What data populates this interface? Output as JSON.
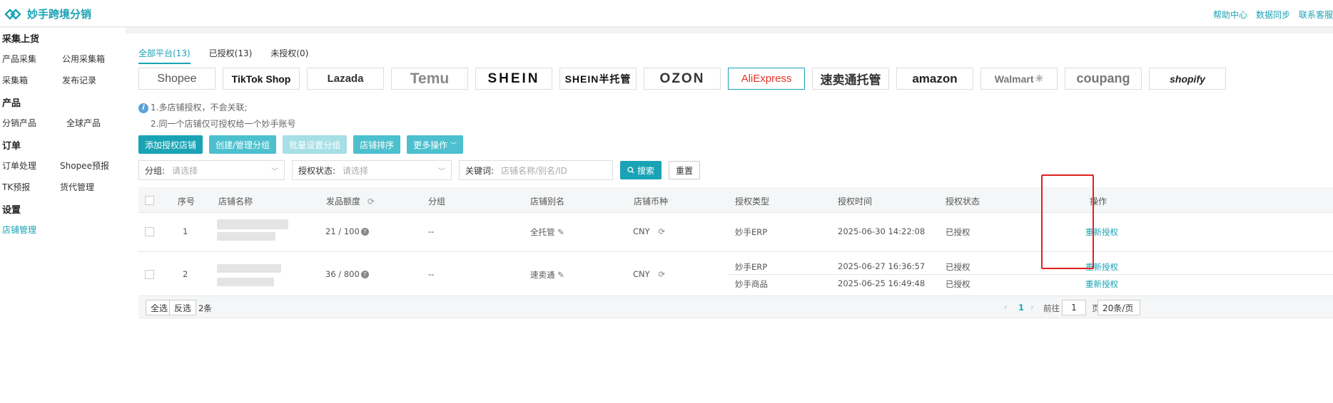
{
  "header": {
    "logo_text": "妙手跨境分销",
    "links": [
      "帮助中心",
      "数据同步",
      "联系客服"
    ]
  },
  "sidebar": {
    "sections": [
      {
        "title": "采集上货",
        "items": [
          "产品采集",
          "公用采集箱",
          "采集箱",
          "发布记录"
        ]
      },
      {
        "title": "产品",
        "items": [
          "分销产品",
          "全球产品"
        ]
      },
      {
        "title": "订单",
        "items": [
          "订单处理",
          "Shopee预报",
          "TK预报",
          "货代管理"
        ]
      },
      {
        "title": "设置",
        "items": [
          "店铺管理"
        ]
      }
    ],
    "active_item": "店铺管理"
  },
  "tabs": [
    {
      "label": "全部平台(13)",
      "active": true
    },
    {
      "label": "已授权(13)",
      "active": false
    },
    {
      "label": "未授权(0)",
      "active": false
    }
  ],
  "platforms": [
    {
      "name": "Shopee",
      "color": "#555555"
    },
    {
      "name": "TikTok Shop",
      "color": "#111111"
    },
    {
      "name": "Lazada",
      "color": "#333333"
    },
    {
      "name": "Temu",
      "color": "#888888"
    },
    {
      "name": "SHEIN",
      "color": "#111111"
    },
    {
      "name": "SHEIN半托管",
      "color": "#111111"
    },
    {
      "name": "OZON",
      "color": "#333333"
    },
    {
      "name": "AliExpress",
      "color": "#e43225"
    },
    {
      "name": "速卖通托管",
      "color": "#333333"
    },
    {
      "name": "amazon",
      "color": "#222222"
    },
    {
      "name": "Walmart",
      "color": "#777777"
    },
    {
      "name": "coupang",
      "color": "#777777"
    },
    {
      "name": "shopify",
      "color": "#222222"
    }
  ],
  "notes": [
    "1.多店铺授权，不会关联;",
    "2.同一个店铺仅可授权给一个妙手账号"
  ],
  "actions": [
    "添加授权店铺",
    "创建/管理分组",
    "批量设置分组",
    "店铺排序",
    "更多操作"
  ],
  "filters": {
    "group_label": "分组:",
    "group_placeholder": "请选择",
    "status_label": "授权状态:",
    "status_placeholder": "请选择",
    "keyword_label": "关键词:",
    "keyword_placeholder": "店铺名称/别名/ID",
    "search_label": "搜索",
    "reset_label": "重置"
  },
  "table": {
    "headers": [
      "序号",
      "店铺名称",
      "发品额度",
      "分组",
      "店铺别名",
      "店铺币种",
      "授权类型",
      "授权时间",
      "授权状态",
      "操作"
    ],
    "rows": [
      {
        "index": "1",
        "quota": "21 / 100",
        "group": "--",
        "alias": "全托管",
        "currency": "CNY",
        "auths": [
          {
            "type": "妙手ERP",
            "time": "2025-06-30 14:22:08",
            "status": "已授权",
            "action": "重新授权"
          }
        ]
      },
      {
        "index": "2",
        "quota": "36 / 800",
        "group": "--",
        "alias": "速卖通",
        "currency": "CNY",
        "auths": [
          {
            "type": "妙手ERP",
            "time": "2025-06-27 16:36:57",
            "status": "已授权",
            "action": "重新授权"
          },
          {
            "type": "妙手商品",
            "time": "2025-06-25 16:49:48",
            "status": "已授权",
            "action": "重新授权"
          }
        ]
      }
    ]
  },
  "footer": {
    "select_all": "全选",
    "invert": "反选",
    "count": "2条",
    "page": "1",
    "goto_label": "前往",
    "goto_value": "1",
    "page_unit": "页",
    "page_size": "20条/页"
  },
  "colors": {
    "accent": "#1aa3b5",
    "highlight": "#e02020"
  }
}
